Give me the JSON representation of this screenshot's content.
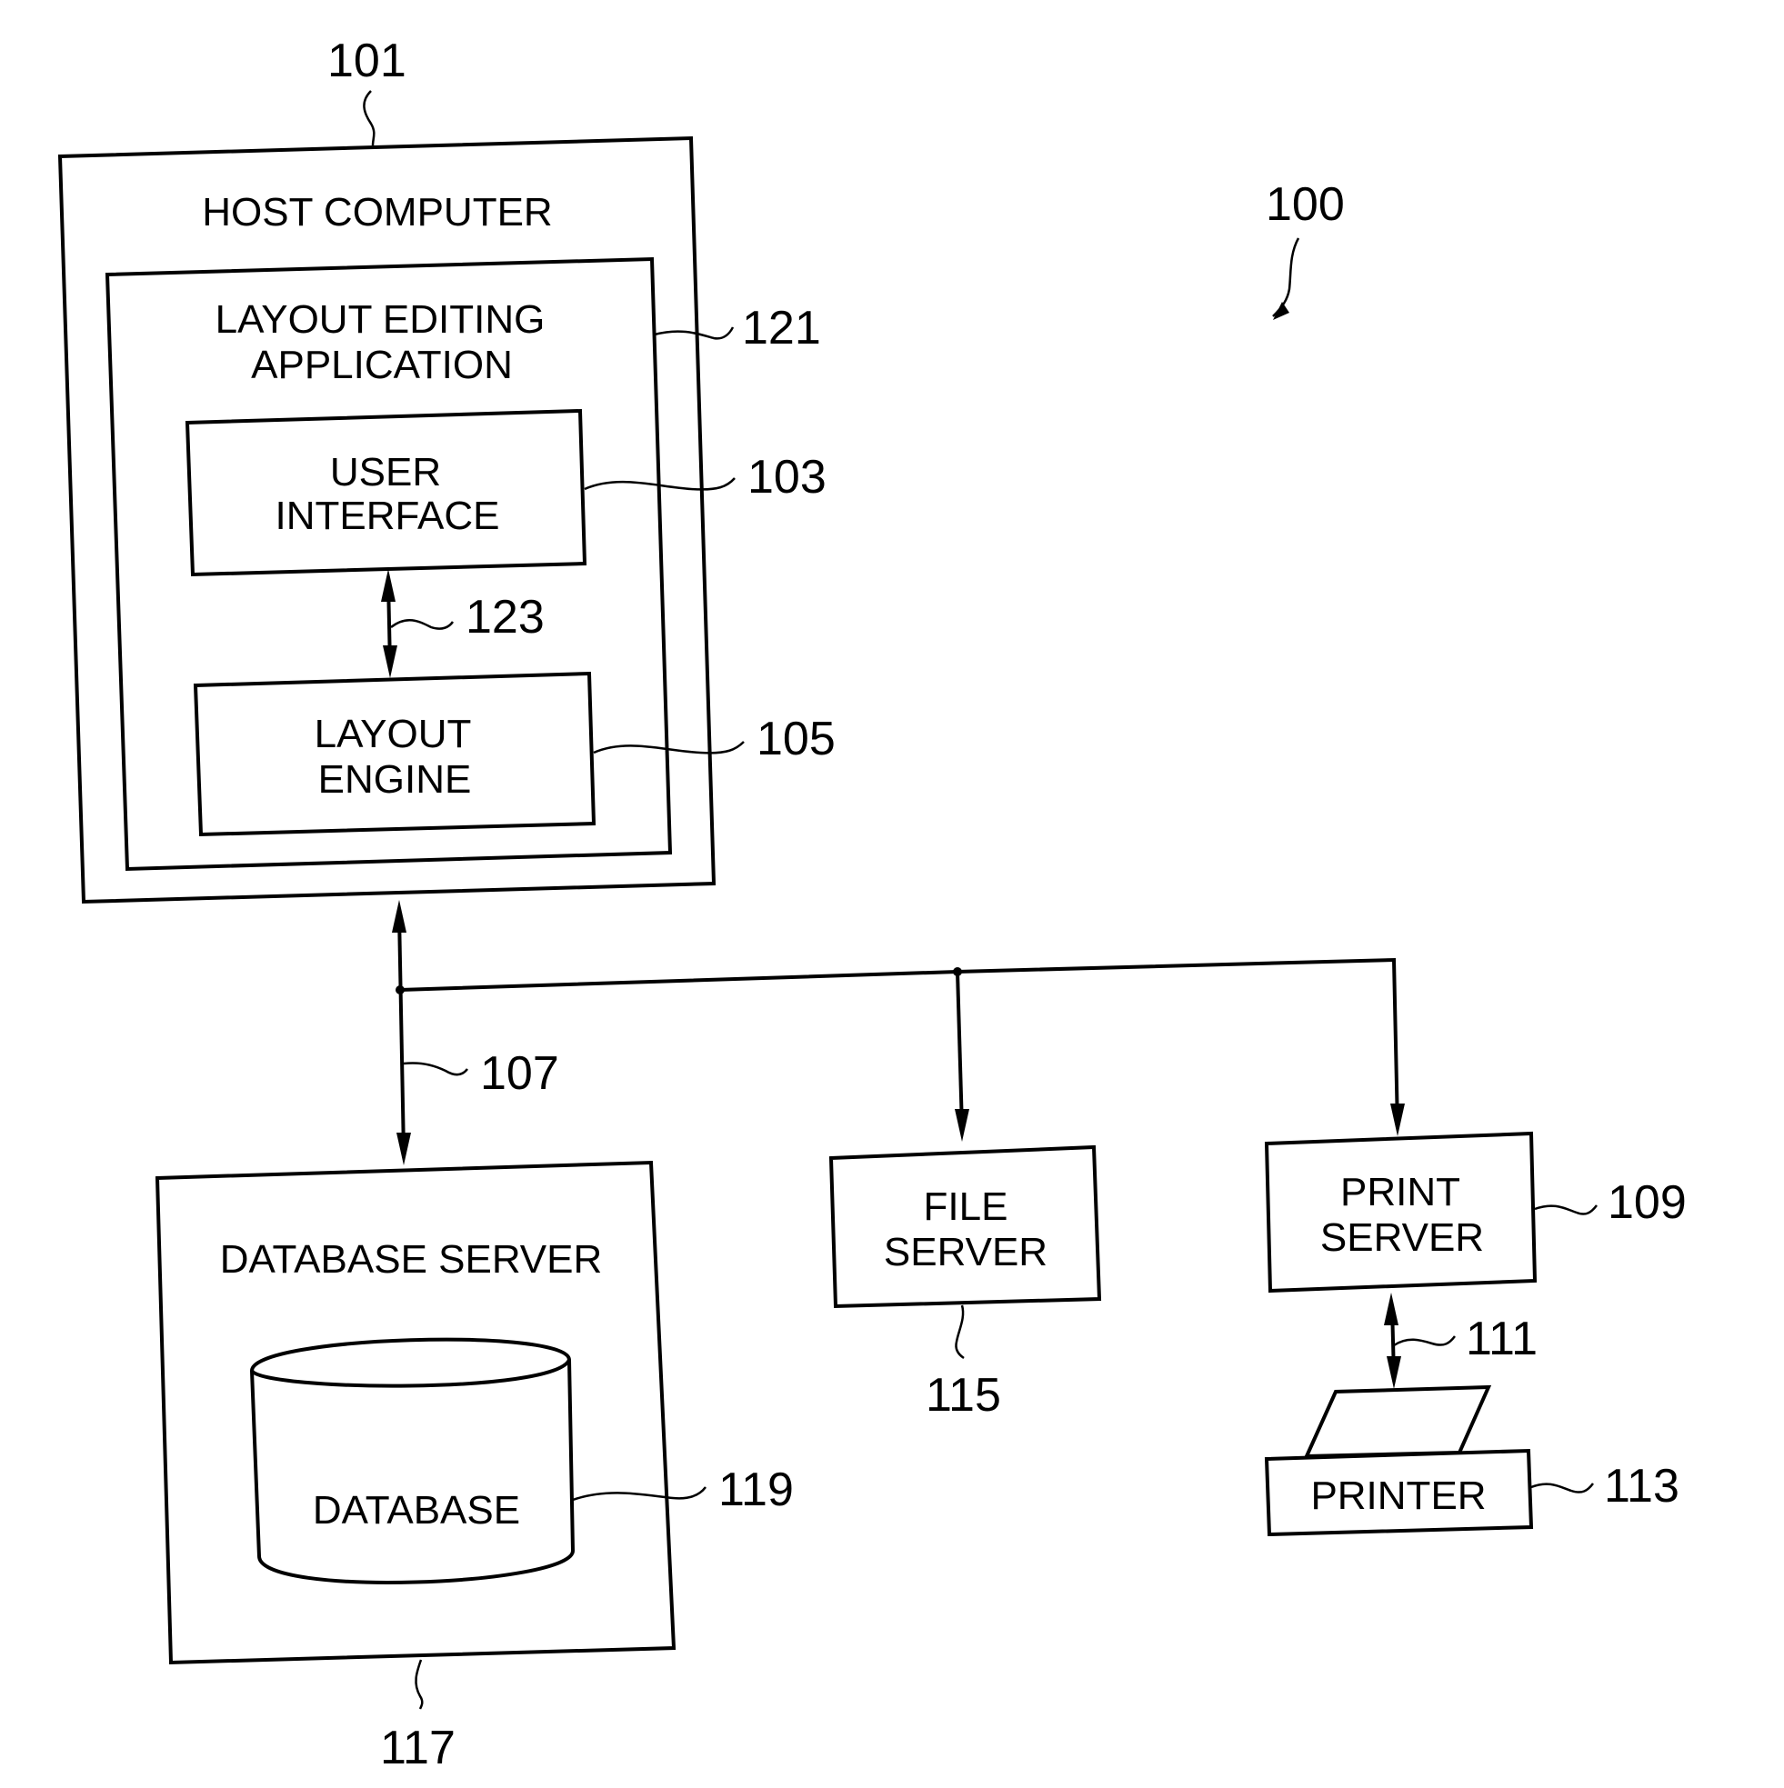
{
  "figure": {
    "system_ref": "100",
    "host_computer": {
      "ref": "101",
      "label": "HOST COMPUTER"
    },
    "layout_editing_application": {
      "ref": "121",
      "label_lines": [
        "LAYOUT EDITING",
        "APPLICATION"
      ]
    },
    "user_interface": {
      "ref": "103",
      "label_lines": [
        "USER",
        "INTERFACE"
      ]
    },
    "ui_engine_link": {
      "ref": "123"
    },
    "layout_engine": {
      "ref": "105",
      "label_lines": [
        "LAYOUT",
        "ENGINE"
      ]
    },
    "network": {
      "ref": "107"
    },
    "database_server": {
      "ref": "117",
      "label": "DATABASE SERVER"
    },
    "database": {
      "ref": "119",
      "label": "DATABASE"
    },
    "file_server": {
      "ref": "115",
      "label_lines": [
        "FILE",
        "SERVER"
      ]
    },
    "print_server": {
      "ref": "109",
      "label_lines": [
        "PRINT",
        "SERVER"
      ]
    },
    "printer_link": {
      "ref": "111"
    },
    "printer": {
      "ref": "113",
      "label": "PRINTER"
    }
  }
}
